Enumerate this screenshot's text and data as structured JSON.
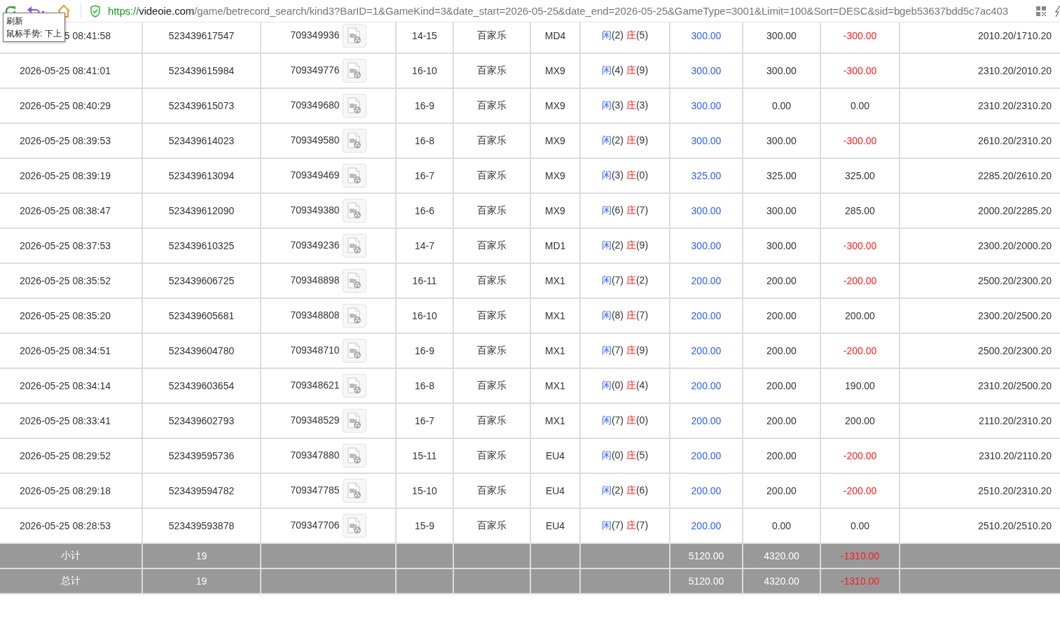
{
  "toolbar": {
    "url": {
      "scheme": "https://",
      "host": "videoie.com",
      "path": "/game/betrecord_search/kind3?BarID=1&GameKind=3&date_start=2026-05-25&date_end=2026-05-25&GameType=3001&Limit=100&Sort=DESC&sid=bgeb53637bdd5c7ac403"
    },
    "tooltip": {
      "title": "刷新",
      "hint": "鼠标手势: 下上"
    }
  },
  "rows": [
    {
      "time": "5 08:41:58",
      "order": "523439617547",
      "round": "709349936",
      "shoe": "14-15",
      "game": "百家乐",
      "table": "MD4",
      "player_label": "闲",
      "player": "(2)",
      "banker_label": "庄",
      "banker": "(5)",
      "bet": "300.00",
      "valid": "300.00",
      "payout": "-300.00",
      "loss": true,
      "balance": "2010.20/1710.20"
    },
    {
      "time": "2026-05-25 08:41:01",
      "order": "523439615984",
      "round": "709349776",
      "shoe": "16-10",
      "game": "百家乐",
      "table": "MX9",
      "player_label": "闲",
      "player": "(4)",
      "banker_label": "庄",
      "banker": "(9)",
      "bet": "300.00",
      "valid": "300.00",
      "payout": "-300.00",
      "loss": true,
      "balance": "2310.20/2010.20"
    },
    {
      "time": "2026-05-25 08:40:29",
      "order": "523439615073",
      "round": "709349680",
      "shoe": "16-9",
      "game": "百家乐",
      "table": "MX9",
      "player_label": "闲",
      "player": "(3)",
      "banker_label": "庄",
      "banker": "(3)",
      "bet": "300.00",
      "valid": "0.00",
      "payout": "0.00",
      "loss": false,
      "balance": "2310.20/2310.20"
    },
    {
      "time": "2026-05-25 08:39:53",
      "order": "523439614023",
      "round": "709349580",
      "shoe": "16-8",
      "game": "百家乐",
      "table": "MX9",
      "player_label": "闲",
      "player": "(2)",
      "banker_label": "庄",
      "banker": "(9)",
      "bet": "300.00",
      "valid": "300.00",
      "payout": "-300.00",
      "loss": true,
      "balance": "2610.20/2310.20"
    },
    {
      "time": "2026-05-25 08:39:19",
      "order": "523439613094",
      "round": "709349469",
      "shoe": "16-7",
      "game": "百家乐",
      "table": "MX9",
      "player_label": "闲",
      "player": "(3)",
      "banker_label": "庄",
      "banker": "(0)",
      "bet": "325.00",
      "valid": "325.00",
      "payout": "325.00",
      "loss": false,
      "balance": "2285.20/2610.20"
    },
    {
      "time": "2026-05-25 08:38:47",
      "order": "523439612090",
      "round": "709349380",
      "shoe": "16-6",
      "game": "百家乐",
      "table": "MX9",
      "player_label": "闲",
      "player": "(6)",
      "banker_label": "庄",
      "banker": "(7)",
      "bet": "300.00",
      "valid": "300.00",
      "payout": "285.00",
      "loss": false,
      "balance": "2000.20/2285.20"
    },
    {
      "time": "2026-05-25 08:37:53",
      "order": "523439610325",
      "round": "709349236",
      "shoe": "14-7",
      "game": "百家乐",
      "table": "MD1",
      "player_label": "闲",
      "player": "(2)",
      "banker_label": "庄",
      "banker": "(9)",
      "bet": "300.00",
      "valid": "300.00",
      "payout": "-300.00",
      "loss": true,
      "balance": "2300.20/2000.20"
    },
    {
      "time": "2026-05-25 08:35:52",
      "order": "523439606725",
      "round": "709348898",
      "shoe": "16-11",
      "game": "百家乐",
      "table": "MX1",
      "player_label": "闲",
      "player": "(7)",
      "banker_label": "庄",
      "banker": "(2)",
      "bet": "200.00",
      "valid": "200.00",
      "payout": "-200.00",
      "loss": true,
      "balance": "2500.20/2300.20"
    },
    {
      "time": "2026-05-25 08:35:20",
      "order": "523439605681",
      "round": "709348808",
      "shoe": "16-10",
      "game": "百家乐",
      "table": "MX1",
      "player_label": "闲",
      "player": "(8)",
      "banker_label": "庄",
      "banker": "(7)",
      "bet": "200.00",
      "valid": "200.00",
      "payout": "200.00",
      "loss": false,
      "balance": "2300.20/2500.20"
    },
    {
      "time": "2026-05-25 08:34:51",
      "order": "523439604780",
      "round": "709348710",
      "shoe": "16-9",
      "game": "百家乐",
      "table": "MX1",
      "player_label": "闲",
      "player": "(7)",
      "banker_label": "庄",
      "banker": "(9)",
      "bet": "200.00",
      "valid": "200.00",
      "payout": "-200.00",
      "loss": true,
      "balance": "2500.20/2300.20"
    },
    {
      "time": "2026-05-25 08:34:14",
      "order": "523439603654",
      "round": "709348621",
      "shoe": "16-8",
      "game": "百家乐",
      "table": "MX1",
      "player_label": "闲",
      "player": "(0)",
      "banker_label": "庄",
      "banker": "(4)",
      "bet": "200.00",
      "valid": "200.00",
      "payout": "190.00",
      "loss": false,
      "balance": "2310.20/2500.20"
    },
    {
      "time": "2026-05-25 08:33:41",
      "order": "523439602793",
      "round": "709348529",
      "shoe": "16-7",
      "game": "百家乐",
      "table": "MX1",
      "player_label": "闲",
      "player": "(7)",
      "banker_label": "庄",
      "banker": "(0)",
      "bet": "200.00",
      "valid": "200.00",
      "payout": "200.00",
      "loss": false,
      "balance": "2110.20/2310.20"
    },
    {
      "time": "2026-05-25 08:29:52",
      "order": "523439595736",
      "round": "709347880",
      "shoe": "15-11",
      "game": "百家乐",
      "table": "EU4",
      "player_label": "闲",
      "player": "(0)",
      "banker_label": "庄",
      "banker": "(5)",
      "bet": "200.00",
      "valid": "200.00",
      "payout": "-200.00",
      "loss": true,
      "balance": "2310.20/2110.20"
    },
    {
      "time": "2026-05-25 08:29:18",
      "order": "523439594782",
      "round": "709347785",
      "shoe": "15-10",
      "game": "百家乐",
      "table": "EU4",
      "player_label": "闲",
      "player": "(2)",
      "banker_label": "庄",
      "banker": "(6)",
      "bet": "200.00",
      "valid": "200.00",
      "payout": "-200.00",
      "loss": true,
      "balance": "2510.20/2310.20"
    },
    {
      "time": "2026-05-25 08:28:53",
      "order": "523439593878",
      "round": "709347706",
      "shoe": "15-9",
      "game": "百家乐",
      "table": "EU4",
      "player_label": "闲",
      "player": "(7)",
      "banker_label": "庄",
      "banker": "(7)",
      "bet": "200.00",
      "valid": "0.00",
      "payout": "0.00",
      "loss": false,
      "balance": "2510.20/2510.20"
    }
  ],
  "totals": [
    {
      "label": "小计",
      "count": "19",
      "bet": "5120.00",
      "valid": "4320.00",
      "payout": "-1310.00",
      "loss": true
    },
    {
      "label": "总计",
      "count": "19",
      "bet": "5120.00",
      "valid": "4320.00",
      "payout": "-1310.00",
      "loss": true
    }
  ]
}
